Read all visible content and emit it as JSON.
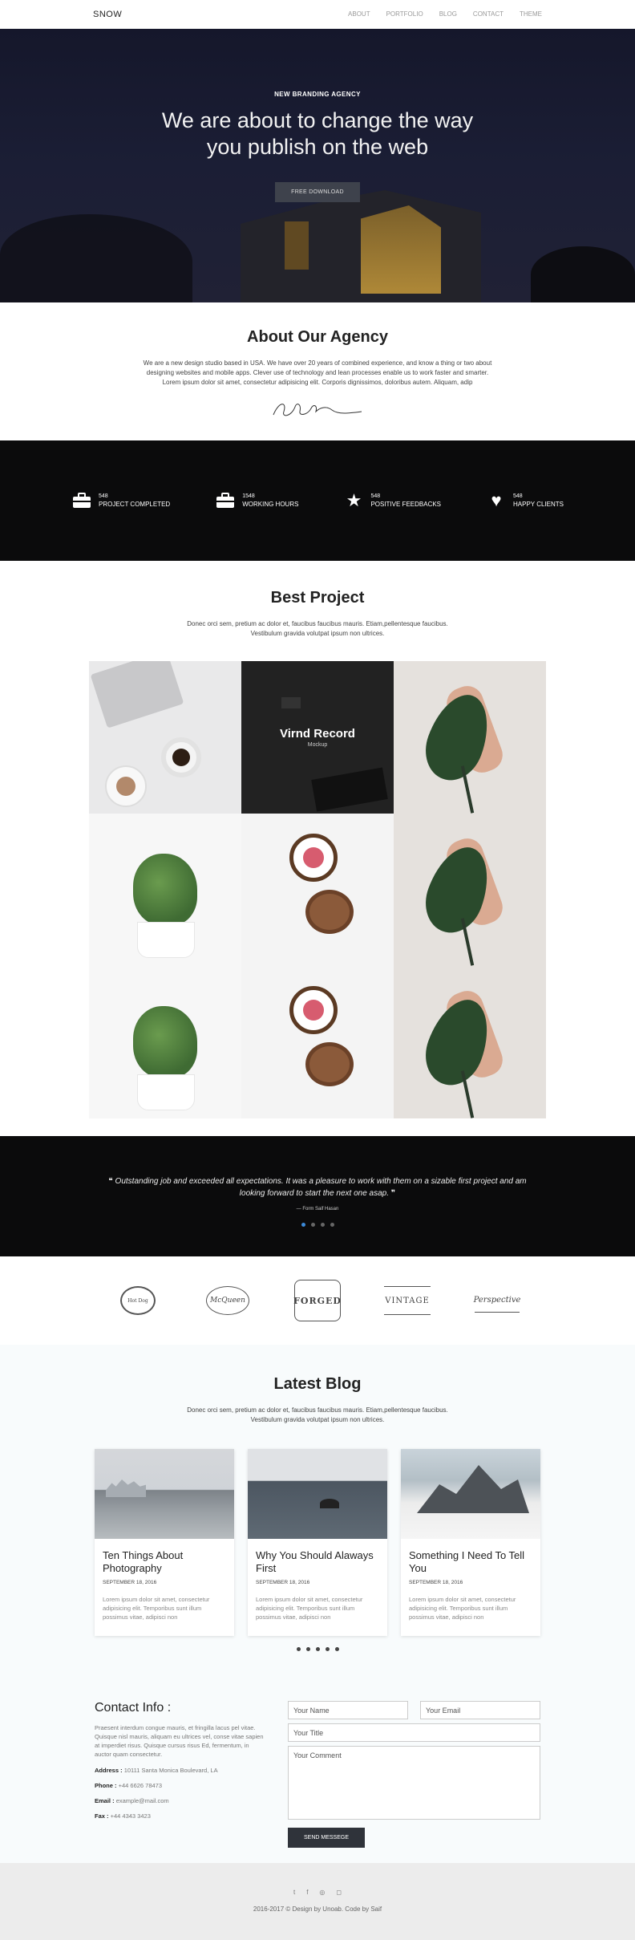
{
  "nav": {
    "brand": "SNOW",
    "items": [
      "ABOUT",
      "PORTFOLIO",
      "BLOG",
      "CONTACT",
      "THEME"
    ]
  },
  "hero": {
    "kicker": "NEW BRANDING AGENCY",
    "title": "We are about to change the way you publish on the web",
    "button": "FREE DOWNLOAD"
  },
  "about": {
    "title": "About Our Agency",
    "text": "We are a new design studio based in USA. We have over 20 years of combined experience, and know a thing or two about designing websites and mobile apps. Clever use of technology and lean processes enable us to work faster and smarter. Lorem ipsum dolor sit amet, consectetur adipisicing elit. Corporis dignissimos, doloribus autem. Aliquam, adip"
  },
  "stats": [
    {
      "icon": "briefcase-icon",
      "glyph": "💼",
      "number": "548",
      "label": "PROJECT COMPLETED"
    },
    {
      "icon": "briefcase-icon",
      "glyph": "💼",
      "number": "1548",
      "label": "WORKING HOURS"
    },
    {
      "icon": "star-icon",
      "glyph": "★",
      "number": "548",
      "label": "POSITIVE FEEDBACKS"
    },
    {
      "icon": "heart-icon",
      "glyph": "♥",
      "number": "548",
      "label": "HAPPY CLIENTS"
    }
  ],
  "projects": {
    "title": "Best Project",
    "text": "Donec orci sem, pretium ac dolor et, faucibus faucibus mauris. Etiam,pellentesque faucibus. Vestibulum gravida volutpat ipsum non ultrices.",
    "featured_title": "Virnd Record",
    "featured_subtitle": "Mockup"
  },
  "testimonial": {
    "quote": "Outstanding job and exceeded all expectations. It was a pleasure to work with them on a sizable first project and am looking forward to start the next one asap.",
    "author": "— Form Saif Hasan"
  },
  "blog": {
    "title": "Latest Blog",
    "text": "Donec orci sem, pretium ac dolor et, faucibus faucibus mauris. Etiam,pellentesque faucibus. Vestibulum gravida volutpat ipsum non ultrices.",
    "posts": [
      {
        "title": "Ten Things About Photography",
        "date": "SEPTEMBER 18, 2016",
        "excerpt": "Lorem ipsum dolor sit amet, consectetur adipisicing elit. Temporibus sunt illum possimus vitae, adipisci non"
      },
      {
        "title": "Why You Should Alaways First",
        "date": "SEPTEMBER 18, 2016",
        "excerpt": "Lorem ipsum dolor sit amet, consectetur adipisicing elit. Temporibus sunt illum possimus vitae, adipisci non"
      },
      {
        "title": "Something I Need To Tell You",
        "date": "SEPTEMBER 18, 2016",
        "excerpt": "Lorem ipsum dolor sit amet, consectetur adipisicing elit. Temporibus sunt illum possimus vitae, adipisci non"
      }
    ]
  },
  "contact": {
    "title": "Contact Info :",
    "desc": "Praesent interdum congue mauris, et fringilla lacus pel vitae. Quisque nisl mauris, aliquam eu ultrices vel, conse vitae sapien at imperdiet risus. Quisque cursus risus Ed, fermentum, in auctor quam consectetur.",
    "address_label": "Address :",
    "address": "10111 Santa Monica Boulevard, LA",
    "phone_label": "Phone :",
    "phone": "+44 6626 78473",
    "email_label": "Email :",
    "email": "example@mail.com",
    "fax_label": "Fax :",
    "fax": "+44 4343 3423",
    "form": {
      "name": "Your Name",
      "email": "Your Email",
      "title": "Your Title",
      "comment": "Your Comment",
      "send": "SEND MESSEGE"
    }
  },
  "footer": {
    "socials": [
      {
        "icon": "twitter-icon",
        "glyph": "t"
      },
      {
        "icon": "facebook-icon",
        "glyph": "f"
      },
      {
        "icon": "dribbble-icon",
        "glyph": "◎"
      },
      {
        "icon": "instagram-icon",
        "glyph": "◻"
      }
    ],
    "copyright": "2016-2017 © Design by Unoab. Code by Saif"
  },
  "logos": [
    "Hot Dog",
    "McQueen",
    "FORGED",
    "VINTAGE",
    "Perspective"
  ],
  "colors": {
    "dark": "#0b0b0c",
    "accent": "#3c8ad8",
    "button": "#2f333a"
  }
}
